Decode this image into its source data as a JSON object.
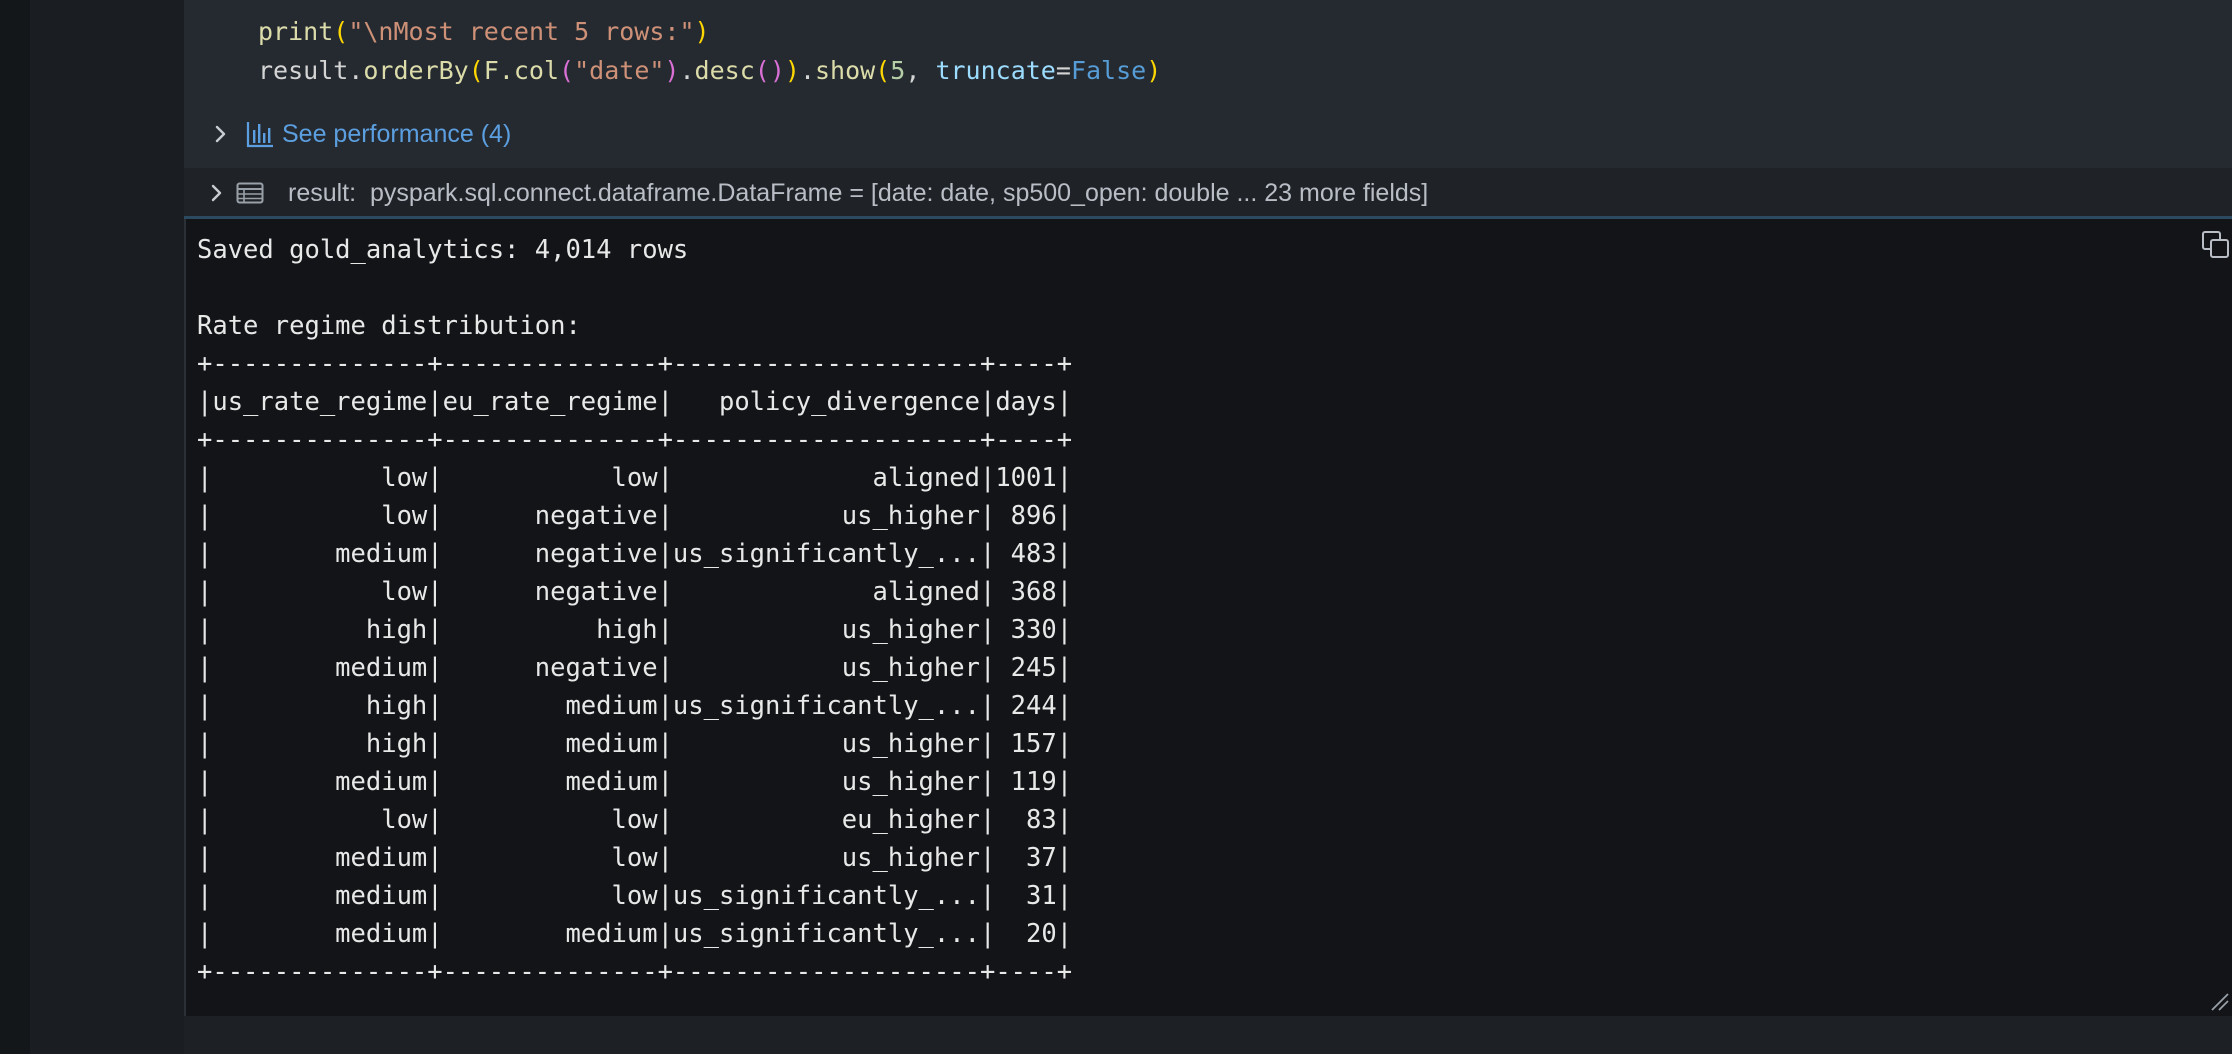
{
  "code": {
    "line1": {
      "fn": "print",
      "open": "(",
      "str": "\"\\nMost recent 5 rows:\"",
      "close": ")"
    },
    "line2": {
      "obj": "result.",
      "m1": "orderBy",
      "p1": "(",
      "m2": "F.col",
      "p2": "(",
      "s1": "\"date\"",
      "p3": ")",
      "dot": ".",
      "m3": "desc",
      "p4": "()",
      "p5": ")",
      "dot2": ".",
      "m4": "show",
      "p6": "(",
      "n1": "5",
      "comma": ", ",
      "kw": "truncate",
      "eq": "=",
      "bool": "False",
      "p7": ")"
    }
  },
  "performance": {
    "label": "See performance (4)"
  },
  "result_bar": {
    "text": "result:  pyspark.sql.connect.dataframe.DataFrame = [date: date, sp500_open: double ... 23 more fields]"
  },
  "output": {
    "text": "Saved gold_analytics: 4,014 rows\n\nRate regime distribution:\n+--------------+--------------+--------------------+----+\n|us_rate_regime|eu_rate_regime|   policy_divergence|days|\n+--------------+--------------+--------------------+----+\n|           low|           low|             aligned|1001|\n|           low|      negative|           us_higher| 896|\n|        medium|      negative|us_significantly_...| 483|\n|           low|      negative|             aligned| 368|\n|          high|          high|           us_higher| 330|\n|        medium|      negative|           us_higher| 245|\n|          high|        medium|us_significantly_...| 244|\n|          high|        medium|           us_higher| 157|\n|        medium|        medium|           us_higher| 119|\n|           low|           low|           eu_higher|  83|\n|        medium|           low|           us_higher|  37|\n|        medium|           low|us_significantly_...|  31|\n|        medium|        medium|us_significantly_...|  20|\n+--------------+--------------+--------------------+----+"
  },
  "icons": {
    "expand": "chevron-right-icon",
    "performance": "bar-chart-icon",
    "table": "table-icon",
    "copy": "copy-icon",
    "resize": "resize-handle-icon"
  },
  "colors": {
    "link": "#5c9fe0",
    "code_bg": "#252a30",
    "output_bg": "#121417"
  }
}
